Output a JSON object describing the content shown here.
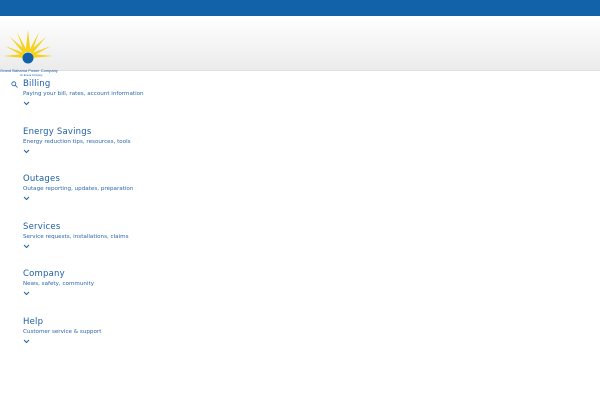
{
  "brand": {
    "name": "Grand Bahama Power Company",
    "tagline": "An Emera Company",
    "colors": {
      "primary_blue": "#1162a8",
      "text_blue": "#1d5ea7",
      "sun_yellow": "#f6d21d"
    }
  },
  "header": {
    "search_icon": "search-icon"
  },
  "menu": {
    "items": [
      {
        "title": "Billing",
        "description": "Paying your bill, rates, account information",
        "icon": "chevron-down-icon"
      },
      {
        "title": "Energy Savings",
        "description": "Energy reduction tips, resources, tools",
        "icon": "chevron-down-icon"
      },
      {
        "title": "Outages",
        "description": "Outage reporting, updates, preparation",
        "icon": "chevron-down-icon"
      },
      {
        "title": "Services",
        "description": "Service requests, installations, claims",
        "icon": "chevron-down-icon"
      },
      {
        "title": "Company",
        "description": "News, safety, community",
        "icon": "chevron-down-icon"
      },
      {
        "title": "Help",
        "description": "Customer service & support",
        "icon": "chevron-down-icon"
      }
    ]
  }
}
